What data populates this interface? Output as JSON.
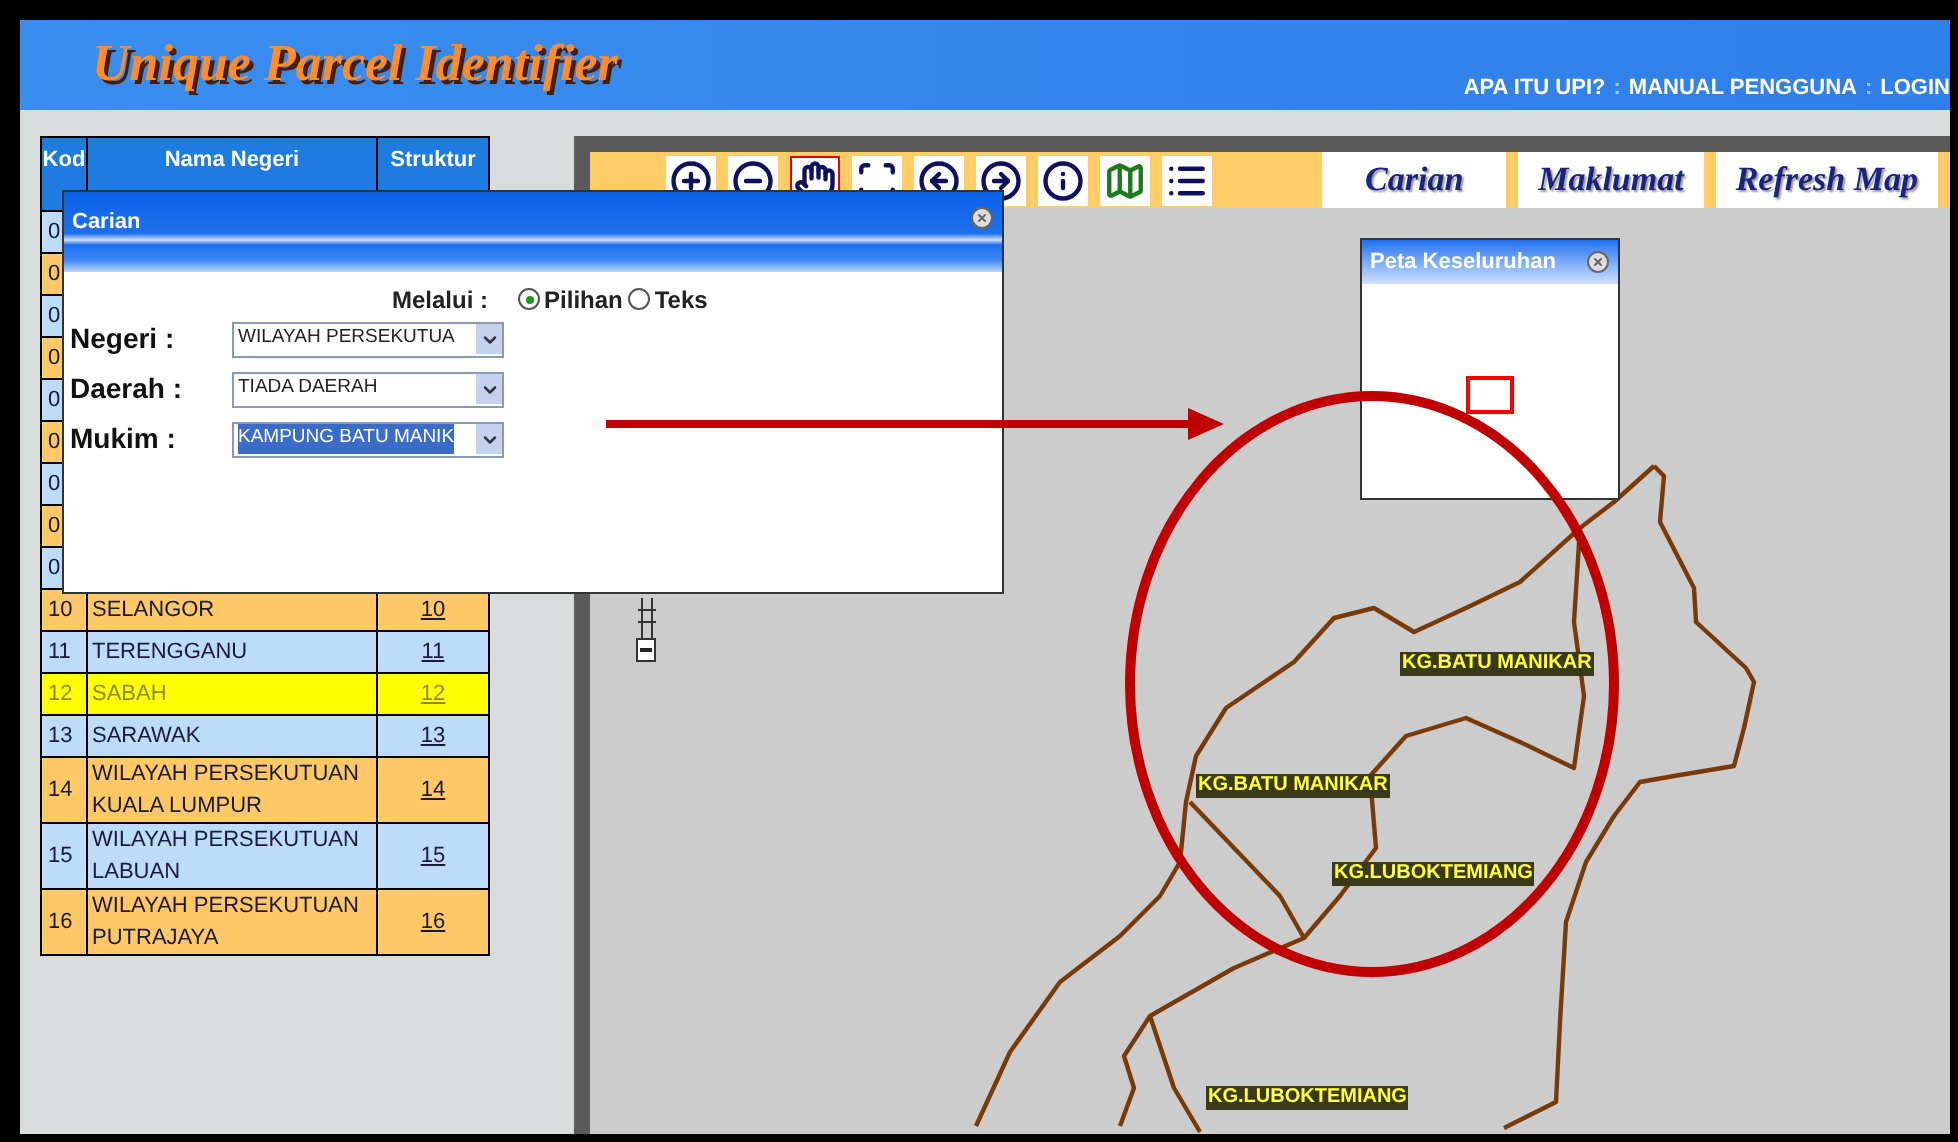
{
  "header": {
    "title": "Unique Parcel Identifier",
    "links": [
      {
        "kind": "link",
        "label": "APA ITU UPI?"
      },
      {
        "kind": "separator",
        "label": ":"
      },
      {
        "kind": "link",
        "label": "MANUAL PENGGUNA"
      },
      {
        "kind": "separator",
        "label": ":"
      },
      {
        "kind": "link",
        "label": "LOGIN"
      }
    ]
  },
  "table": {
    "columns": [
      "Kod",
      "Nama Negeri",
      "Struktur"
    ],
    "rows": [
      {
        "kod": "0",
        "selected": false
      },
      {
        "kod": "0",
        "selected": false
      },
      {
        "kod": "0",
        "selected": false
      },
      {
        "kod": "0",
        "selected": false
      },
      {
        "kod": "0",
        "selected": false
      },
      {
        "kod": "0",
        "selected": false
      },
      {
        "kod": "0",
        "selected": false
      },
      {
        "kod": "0",
        "selected": false
      },
      {
        "kod": "0",
        "selected": false
      },
      {
        "kod": "10",
        "name": "SELANGOR",
        "code": "10",
        "selected": false
      },
      {
        "kod": "11",
        "name": "TERENGGANU",
        "code": "11",
        "selected": false
      },
      {
        "kod": "12",
        "name": "SABAH",
        "code": "12",
        "selected": true
      },
      {
        "kod": "13",
        "name": "SARAWAK",
        "code": "13",
        "selected": false
      },
      {
        "kod": "14",
        "name": "WILAYAH PERSEKUTUAN KUALA LUMPUR",
        "code": "14",
        "selected": false
      },
      {
        "kod": "15",
        "name": "WILAYAH PERSEKUTUAN LABUAN",
        "code": "15",
        "selected": false
      },
      {
        "kod": "16",
        "name": "WILAYAH PERSEKUTUAN PUTRAJAYA",
        "code": "16",
        "selected": false
      }
    ]
  },
  "toolbar": {
    "tools": [
      {
        "kind": "zoom-in",
        "selected": false
      },
      {
        "kind": "zoom-out",
        "selected": false
      },
      {
        "kind": "pan",
        "selected": true
      },
      {
        "kind": "full-extent",
        "selected": false
      },
      {
        "kind": "back",
        "selected": false
      },
      {
        "kind": "forward",
        "selected": false
      },
      {
        "kind": "info",
        "selected": false
      },
      {
        "kind": "overview",
        "selected": false
      },
      {
        "kind": "legend",
        "selected": false
      }
    ],
    "buttons": [
      "Carian",
      "Maklumat",
      "Refresh Map"
    ]
  },
  "overview": {
    "title": "Peta Keseluruhan"
  },
  "map": {
    "labels": [
      "KG.BATU MANIKAR",
      "KG.BATU MANIKAR",
      "KG.LUBOKTEMIANG",
      "KG.LUBOKTEMIANG"
    ]
  },
  "dialog": {
    "title": "Carian",
    "via_label": "Melalui :",
    "options": [
      {
        "label": "Pilihan",
        "selected": true
      },
      {
        "label": "Teks",
        "selected": false
      }
    ],
    "fields": [
      {
        "label": "Negeri :",
        "value": "WILAYAH PERSEKUTUA",
        "highlighted": false
      },
      {
        "label": "Daerah :",
        "value": "TIADA DAERAH",
        "highlighted": false
      },
      {
        "label": "Mukim :",
        "value": "KAMPUNG BATU MANIK",
        "highlighted": true
      }
    ]
  }
}
